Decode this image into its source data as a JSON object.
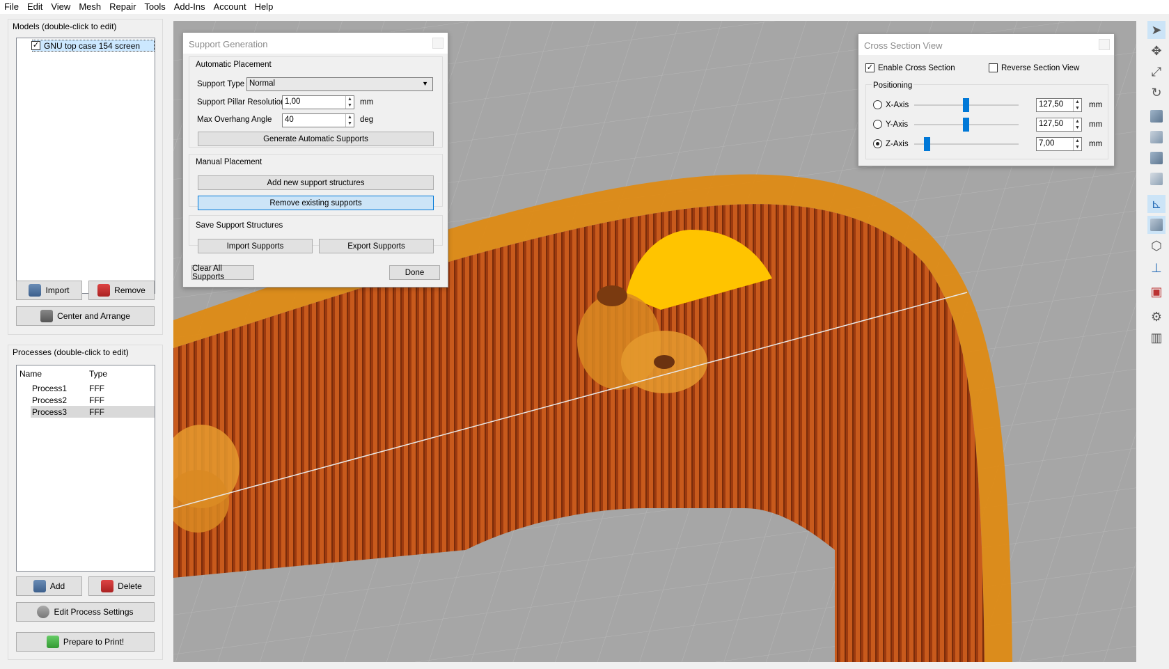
{
  "menu": [
    "File",
    "Edit",
    "View",
    "Mesh",
    "Repair",
    "Tools",
    "Add-Ins",
    "Account",
    "Help"
  ],
  "models": {
    "title": "Models (double-click to edit)",
    "items": [
      {
        "label": "GNU top case 154 screen",
        "checked": true
      }
    ],
    "import_label": "Import",
    "remove_label": "Remove",
    "center_label": "Center and Arrange"
  },
  "processes": {
    "title": "Processes (double-click to edit)",
    "col_name": "Name",
    "col_type": "Type",
    "rows": [
      {
        "name": "Process1",
        "type": "FFF"
      },
      {
        "name": "Process2",
        "type": "FFF"
      },
      {
        "name": "Process3",
        "type": "FFF"
      }
    ],
    "add_label": "Add",
    "delete_label": "Delete",
    "edit_label": "Edit Process Settings",
    "prepare_label": "Prepare to Print!"
  },
  "support": {
    "title": "Support Generation",
    "auto_title": "Automatic Placement",
    "type_label": "Support Type",
    "type_value": "Normal",
    "pillar_label": "Support Pillar Resolution",
    "pillar_value": "1,00",
    "pillar_unit": "mm",
    "angle_label": "Max Overhang Angle",
    "angle_value": "40",
    "angle_unit": "deg",
    "generate_label": "Generate Automatic Supports",
    "manual_title": "Manual Placement",
    "add_label": "Add new support structures",
    "remove_label": "Remove existing supports",
    "save_title": "Save Support Structures",
    "import_label": "Import Supports",
    "export_label": "Export Supports",
    "clear_label": "Clear All Supports",
    "done_label": "Done"
  },
  "cross": {
    "title": "Cross Section View",
    "enable_label": "Enable Cross Section",
    "enable_checked": true,
    "reverse_label": "Reverse Section View",
    "reverse_checked": false,
    "positioning_label": "Positioning",
    "unit": "mm",
    "axes": [
      {
        "label": "X-Axis",
        "value": "127,50",
        "selected": false,
        "slider": 0.5
      },
      {
        "label": "Y-Axis",
        "value": "127,50",
        "selected": false,
        "slider": 0.5
      },
      {
        "label": "Z-Axis",
        "value": "7,00",
        "selected": true,
        "slider": 0.1
      }
    ]
  },
  "colors": {
    "accent": "#0078d7",
    "support_orange": "#c4531a",
    "model_orange": "#e8900e",
    "highlight": "#ffc400",
    "grid_bg": "#a6a6a6"
  }
}
